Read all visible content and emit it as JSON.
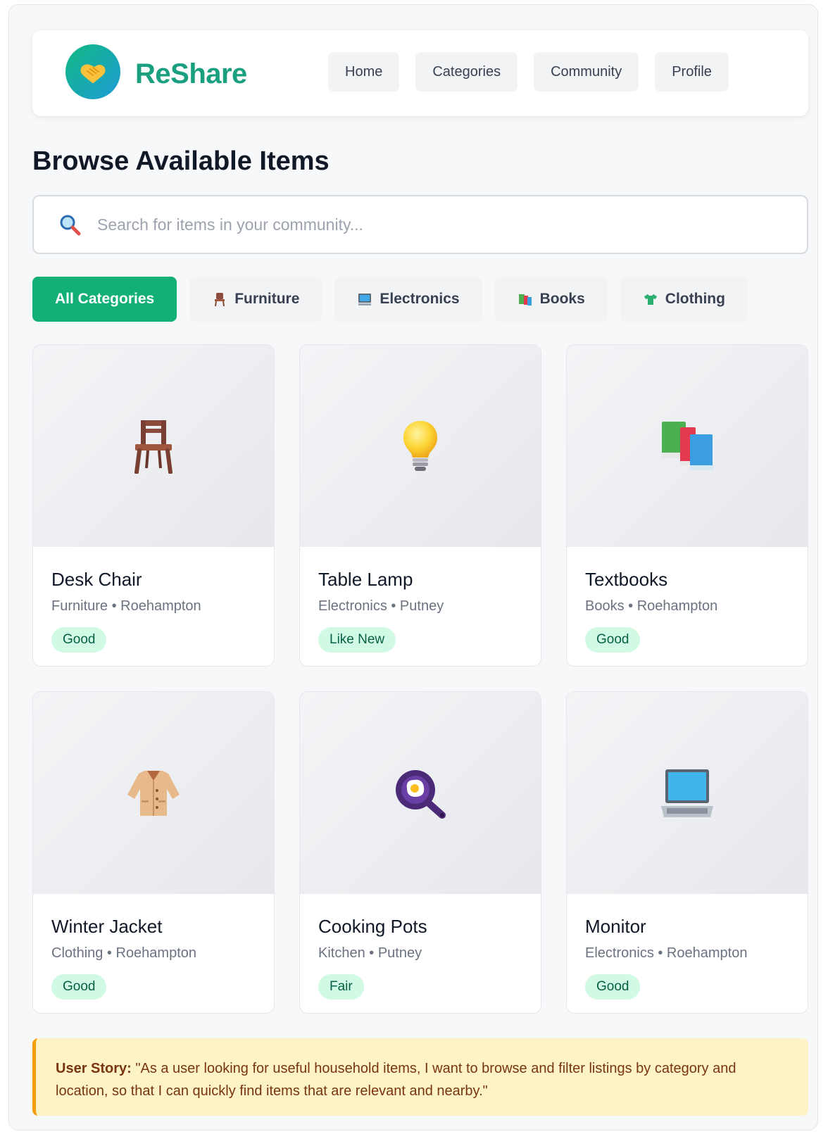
{
  "app": {
    "name": "ReShare",
    "brand_color": "#1aa07f"
  },
  "nav": {
    "items": [
      {
        "label": "Home"
      },
      {
        "label": "Categories"
      },
      {
        "label": "Community"
      },
      {
        "label": "Profile"
      }
    ]
  },
  "page": {
    "title": "Browse Available Items"
  },
  "search": {
    "placeholder": "Search for items in your community...",
    "value": ""
  },
  "categories": {
    "items": [
      {
        "label": "All Categories",
        "icon": "",
        "active": true
      },
      {
        "label": "Furniture",
        "icon": "chair-icon",
        "active": false
      },
      {
        "label": "Electronics",
        "icon": "monitor-icon",
        "active": false
      },
      {
        "label": "Books",
        "icon": "books-icon",
        "active": false
      },
      {
        "label": "Clothing",
        "icon": "shirt-icon",
        "active": false
      }
    ],
    "active_color": "#12b077"
  },
  "listings": [
    {
      "title": "Desk Chair",
      "category": "Furniture",
      "location": "Roehampton",
      "meta": "Furniture • Roehampton",
      "condition": "Good",
      "icon": "chair-icon"
    },
    {
      "title": "Table Lamp",
      "category": "Electronics",
      "location": "Putney",
      "meta": "Electronics • Putney",
      "condition": "Like New",
      "icon": "lightbulb-icon"
    },
    {
      "title": "Textbooks",
      "category": "Books",
      "location": "Roehampton",
      "meta": "Books • Roehampton",
      "condition": "Good",
      "icon": "books-icon"
    },
    {
      "title": "Winter Jacket",
      "category": "Clothing",
      "location": "Roehampton",
      "meta": "Clothing • Roehampton",
      "condition": "Good",
      "icon": "coat-icon"
    },
    {
      "title": "Cooking Pots",
      "category": "Kitchen",
      "location": "Putney",
      "meta": "Kitchen • Putney",
      "condition": "Fair",
      "icon": "frying-pan-icon"
    },
    {
      "title": "Monitor",
      "category": "Electronics",
      "location": "Roehampton",
      "meta": "Electronics • Roehampton",
      "condition": "Good",
      "icon": "laptop-icon"
    }
  ],
  "user_story": {
    "label": "User Story:",
    "text": "\"As a user looking for useful household items, I want to browse and filter listings by category and location, so that I can quickly find items that are relevant and nearby.\""
  }
}
